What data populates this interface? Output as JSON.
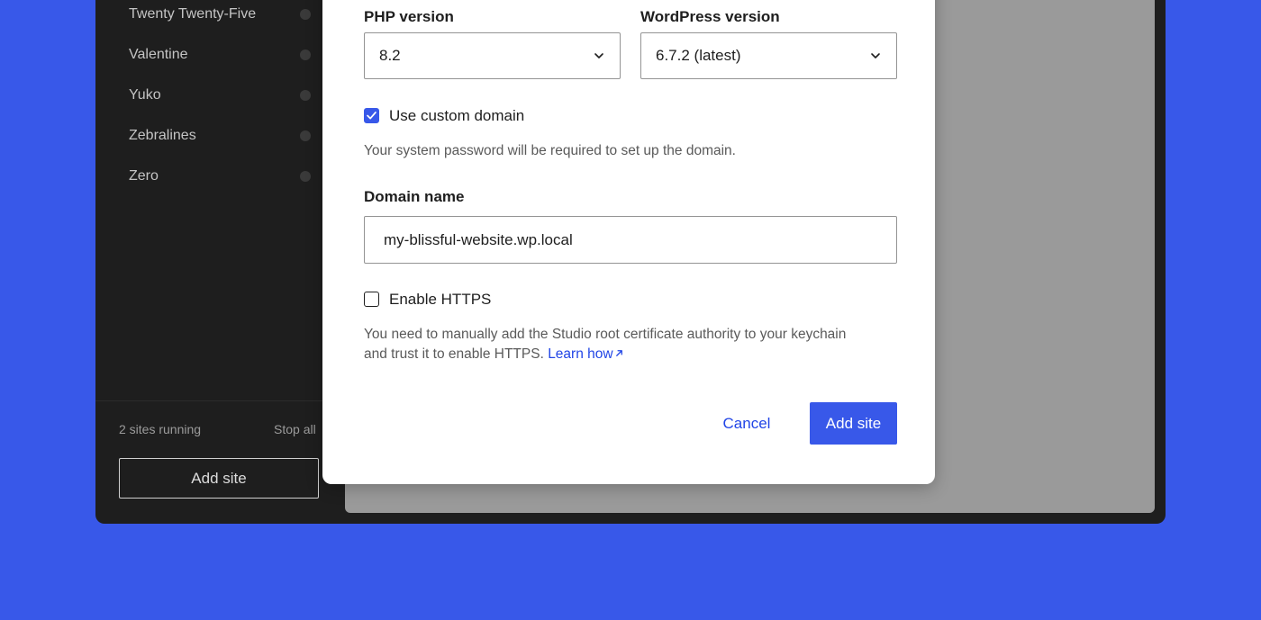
{
  "sidebar": {
    "sites": [
      {
        "name": "Twenty Twenty-Five"
      },
      {
        "name": "Valentine"
      },
      {
        "name": "Yuko"
      },
      {
        "name": "Zebralines"
      },
      {
        "name": "Zero"
      }
    ],
    "running_text": "2 sites running",
    "stop_all_label": "Stop all",
    "add_site_label": "Add site"
  },
  "modal": {
    "php_label": "PHP version",
    "php_value": "8.2",
    "wp_label": "WordPress version",
    "wp_value": "6.7.2 (latest)",
    "custom_domain_label": "Use custom domain",
    "custom_domain_checked": true,
    "custom_domain_help": "Your system password will be required to set up the domain.",
    "domain_label": "Domain name",
    "domain_value": "my-blissful-website.wp.local",
    "https_label": "Enable HTTPS",
    "https_checked": false,
    "https_help_line1": "You need to manually add the Studio root certificate authority to your keychain",
    "https_help_line2": "and trust it to enable HTTPS.",
    "learn_how_label": "Learn how",
    "learn_how_icon": "external-link-arrow-icon",
    "cancel_label": "Cancel",
    "add_site_label": "Add site"
  },
  "colors": {
    "background": "#3858e9",
    "accent": "#3858e9",
    "link": "#2145e6",
    "sidebar_bg": "#1e1e1e",
    "main_pane": "#9a9a9a"
  }
}
